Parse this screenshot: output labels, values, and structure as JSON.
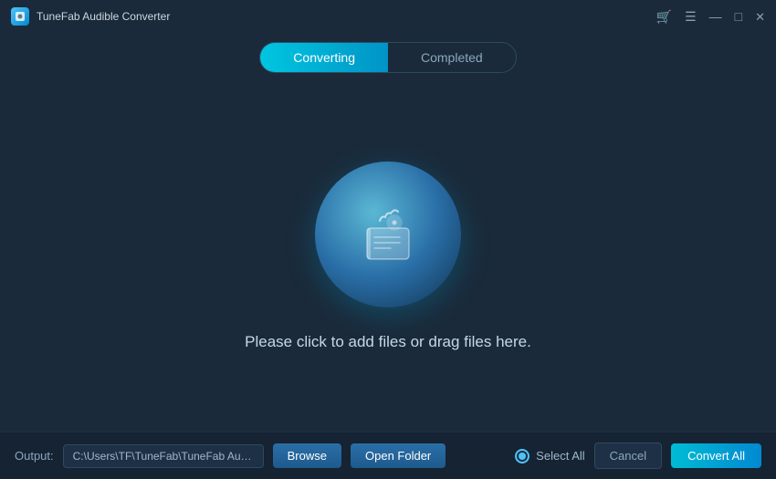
{
  "titleBar": {
    "appName": "TuneFab Audible Converter",
    "controls": {
      "cart": "🛒",
      "menu": "☰",
      "minimize": "—",
      "maximize": "□",
      "close": "✕"
    }
  },
  "tabs": [
    {
      "id": "converting",
      "label": "Converting",
      "active": true
    },
    {
      "id": "completed",
      "label": "Completed",
      "active": false
    }
  ],
  "main": {
    "dropText": "Please click to add files or drag files here."
  },
  "bottomBar": {
    "outputLabel": "Output:",
    "outputPath": "C:\\Users\\TF\\TuneFab\\TuneFab Audible Conv",
    "browseLabel": "Browse",
    "openFolderLabel": "Open Folder",
    "selectAllLabel": "Select All",
    "cancelLabel": "Cancel",
    "convertAllLabel": "Convert All"
  }
}
